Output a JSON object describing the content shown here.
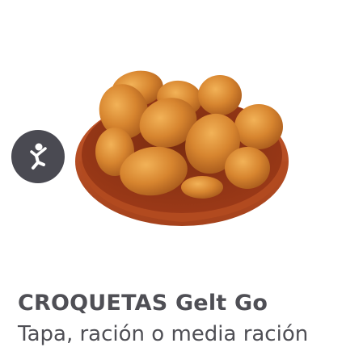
{
  "product": {
    "name": "CROQUETAS Gelt Go",
    "description": "Tapa, ración o media ración",
    "image_subject": "croquetas-in-clay-bowl",
    "badge_icon": "happy-person-icon"
  },
  "colors": {
    "text": "#4f4f55",
    "badge_bg": "#4a4a52",
    "bowl": "#b5481f",
    "croqueta": "#d17a2a"
  }
}
